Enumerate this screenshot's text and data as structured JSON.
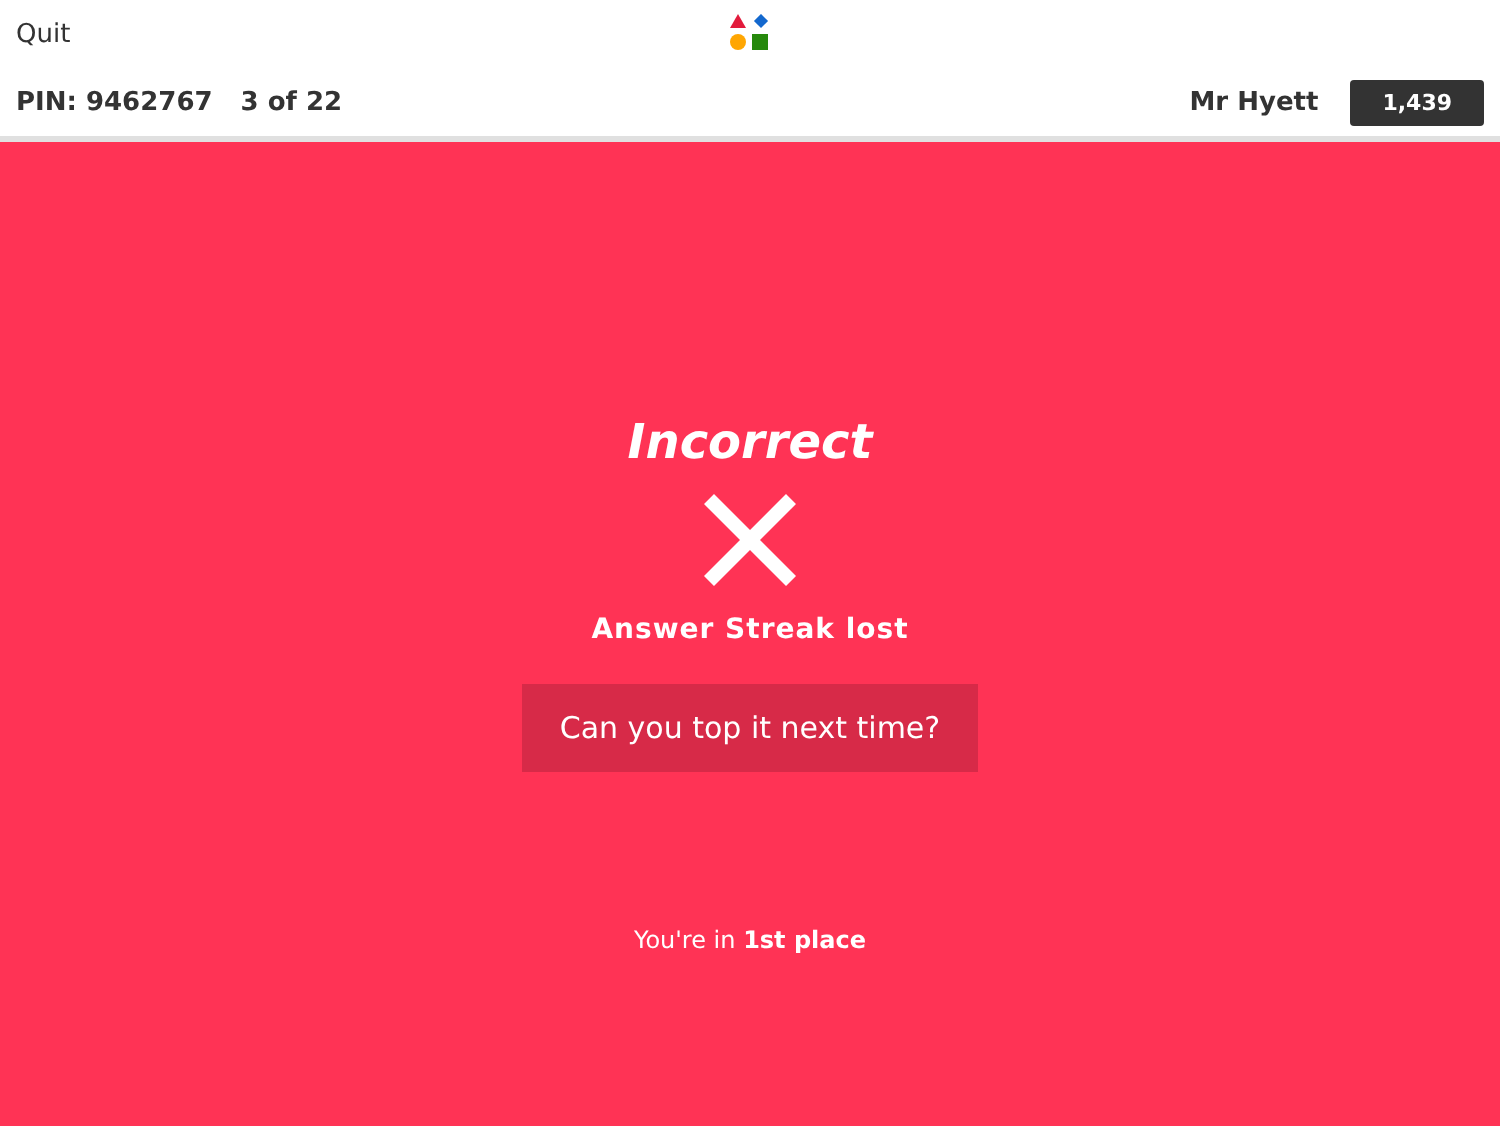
{
  "header": {
    "quit": "Quit",
    "pin": "PIN: 9462767",
    "progress": "3 of 22",
    "player": "Mr Hyett",
    "score": "1,439"
  },
  "result": {
    "kind": "incorrect",
    "title": "Incorrect",
    "streak": "Answer Streak lost",
    "message": "Can you top it next time?",
    "rank": "You're in **1st place**"
  }
}
